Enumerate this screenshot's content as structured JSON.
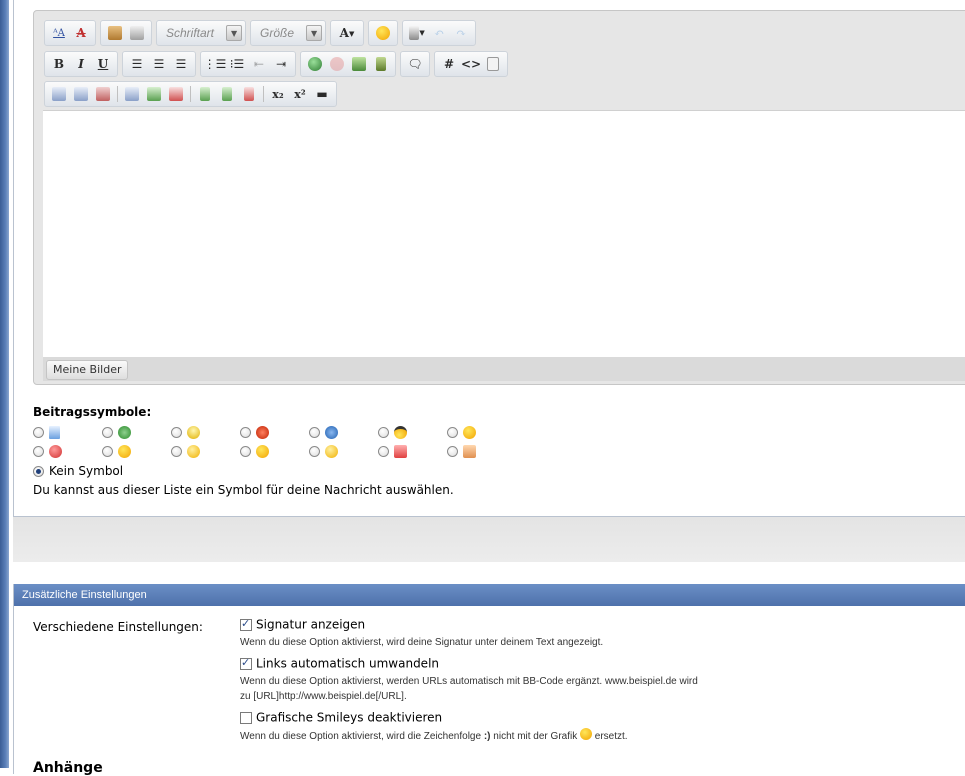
{
  "toolbar": {
    "font_combo": "Schriftart",
    "size_combo": "Größe",
    "font_color_label": "A",
    "bold": "B",
    "italic": "I",
    "underline": "U",
    "hash": "#",
    "code": "<>",
    "subscript": "x₂",
    "superscript": "x²"
  },
  "editor": {
    "my_pictures_button": "Meine Bilder"
  },
  "symbols": {
    "title": "Beitragssymbole:",
    "row1": [
      "document-icon",
      "arrow-icon",
      "bulb-icon",
      "exclamation-icon",
      "question-icon",
      "cool-icon",
      "smile-icon"
    ],
    "row2": [
      "angry-icon",
      "sad-icon",
      "grin-icon",
      "happy-icon",
      "shocked-icon",
      "thumbs-down-icon",
      "thumbs-up-icon"
    ],
    "none_label": "Kein Symbol",
    "hint": "Du kannst aus dieser Liste ein Symbol für deine Nachricht auswählen."
  },
  "settings": {
    "header": "Zusätzliche Einstellungen",
    "row_label": "Verschiedene Einstellungen:",
    "options": [
      {
        "label": "Signatur anzeigen",
        "checked": true,
        "desc": "Wenn du diese Option aktivierst, wird deine Signatur unter deinem Text angezeigt."
      },
      {
        "label": "Links automatisch umwandeln",
        "checked": true,
        "desc_line1": "Wenn du diese Option aktivierst, werden URLs automatisch mit BB-Code ergänzt. www.beispiel.de wird",
        "desc_line2": "zu [URL]http://www.beispiel.de[/URL]."
      },
      {
        "label": "Grafische Smileys deaktivieren",
        "checked": false,
        "desc_pre": "Wenn du diese Option aktivierst, wird die Zeichenfolge",
        "desc_code": ":)",
        "desc_mid": "nicht mit der Grafik",
        "desc_post": "ersetzt."
      }
    ]
  },
  "attachments": {
    "title": "Anhänge"
  }
}
